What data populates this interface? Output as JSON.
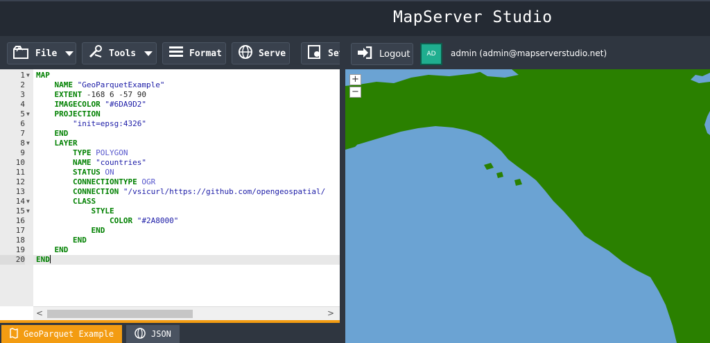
{
  "app": {
    "title": "MapServer Studio"
  },
  "toolbar": {
    "file_label": "File",
    "tools_label": "Tools",
    "format_label": "Format",
    "serve_label": "Serve",
    "settings_label": "Settings"
  },
  "editor": {
    "lines": [
      "MAP",
      "    NAME \"GeoParquetExample\"",
      "    EXTENT -168 6 -57 90",
      "    IMAGECOLOR \"#6DA9D2\"",
      "    PROJECTION",
      "        \"init=epsg:4326\"",
      "    END",
      "    LAYER",
      "        TYPE POLYGON",
      "        NAME \"countries\"",
      "        STATUS ON",
      "        CONNECTIONTYPE OGR",
      "        CONNECTION \"/vsicurl/https://github.com/opengeospatial/",
      "        CLASS",
      "            STYLE",
      "                COLOR \"#2A8000\"",
      "            END",
      "        END",
      "    END",
      "END"
    ],
    "line_numbers": [
      "1",
      "2",
      "3",
      "4",
      "5",
      "6",
      "7",
      "8",
      "9",
      "10",
      "11",
      "12",
      "13",
      "14",
      "15",
      "16",
      "17",
      "18",
      "19",
      "20"
    ],
    "active_line": 20
  },
  "tabs": [
    {
      "label": "GeoParquet Example",
      "active": true
    },
    {
      "label": "JSON",
      "active": false
    }
  ],
  "user": {
    "logout_label": "Logout",
    "avatar_initials": "AD",
    "display": "admin (admin@mapserverstudio.net)"
  },
  "map": {
    "zoom_in": "+",
    "zoom_out": "−",
    "water_color": "#6DA9D2",
    "land_color": "#2A8000"
  }
}
